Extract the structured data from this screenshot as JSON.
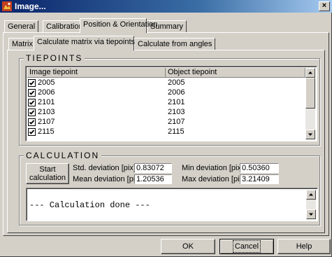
{
  "window": {
    "title": "Image...",
    "close_label": "×"
  },
  "tabs": {
    "general": "General",
    "calibration": "Calibration",
    "position": "Position & Orientation",
    "summary": "Summary"
  },
  "subtabs": {
    "matrix": "Matrix",
    "via_tiepoints": "Calculate matrix via tiepoints",
    "from_angles": "Calculate from angles"
  },
  "tiepoints": {
    "legend": "TIEPOINTS",
    "col_image": "Image tiepoint",
    "col_object": "Object tiepoint",
    "rows": [
      {
        "image": "2005",
        "object": "2005",
        "checked": true
      },
      {
        "image": "2006",
        "object": "2006",
        "checked": true
      },
      {
        "image": "2101",
        "object": "2101",
        "checked": true
      },
      {
        "image": "2103",
        "object": "2103",
        "checked": true
      },
      {
        "image": "2107",
        "object": "2107",
        "checked": true
      },
      {
        "image": "2115",
        "object": "2115",
        "checked": true
      }
    ]
  },
  "calculation": {
    "legend": "CALCULATION",
    "start_line1": "Start",
    "start_line2": "calculation",
    "std_label": "Std. deviation [pix]:",
    "std_value": "0.83072",
    "mean_label": "Mean deviation [pix]:",
    "mean_value": "1.20536",
    "min_label": "Min deviation [pix]:",
    "min_value": "0.50360",
    "max_label": "Max deviation [pix]:",
    "max_value": "3.21409",
    "log": "--- Calculation done ---"
  },
  "buttons": {
    "ok": "OK",
    "cancel": "Cancel",
    "help": "Help"
  }
}
